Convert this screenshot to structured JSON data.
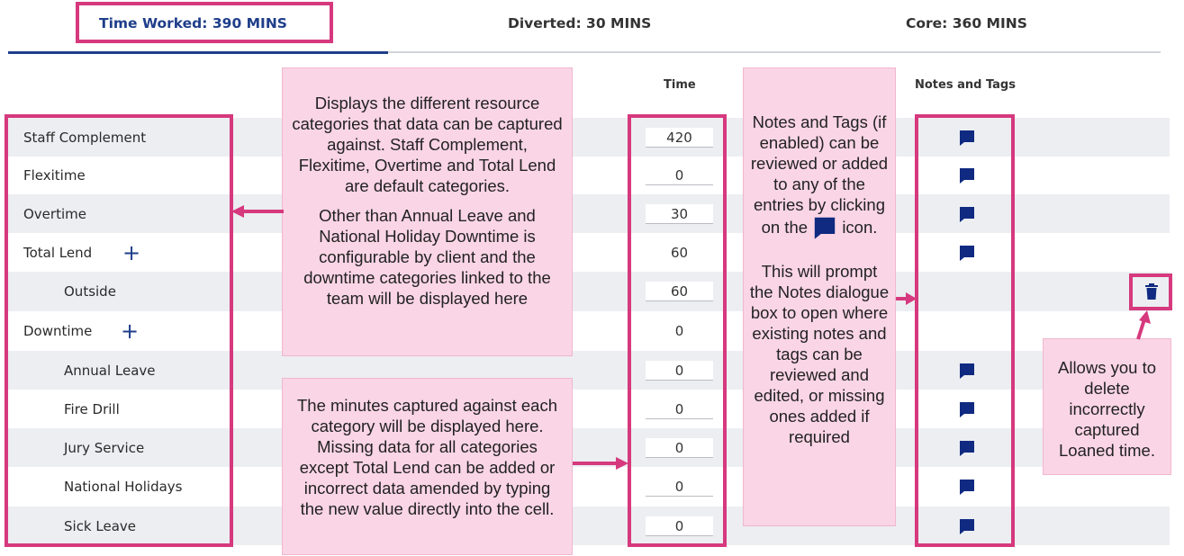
{
  "tabs": [
    {
      "label": "Time Worked: 390 MINS"
    },
    {
      "label": "Diverted: 30 MINS"
    },
    {
      "label": "Core: 360 MINS"
    }
  ],
  "columns": {
    "time": "Time",
    "notes": "Notes and Tags"
  },
  "rows": [
    {
      "label": "Staff Complement",
      "value": "420"
    },
    {
      "label": "Flexitime",
      "value": "0"
    },
    {
      "label": "Overtime",
      "value": "30"
    },
    {
      "label": "Total Lend",
      "value": "60"
    },
    {
      "label": "Outside",
      "value": "60"
    },
    {
      "label": "Downtime",
      "value": "0"
    },
    {
      "label": "Annual Leave",
      "value": "0"
    },
    {
      "label": "Fire Drill",
      "value": "0"
    },
    {
      "label": "Jury Service",
      "value": "0"
    },
    {
      "label": "National Holidays",
      "value": "0"
    },
    {
      "label": "Sick Leave",
      "value": "0"
    }
  ],
  "annotations": {
    "categories_p1": "Displays the different resource categories that data can be captured against. Staff Complement, Flexitime, Overtime and Total Lend are default categories.",
    "categories_p2": "Other than Annual Leave and National Holiday Downtime is configurable by client and the downtime categories linked to the team will be displayed here",
    "minutes": "The minutes captured against each category will be displayed here. Missing data for all categories except Total Lend can be added or incorrect data amended by typing the new value directly into the cell.",
    "notes_p1a": "Notes and Tags (if enabled) can be reviewed or added to any of the entries by clicking on the",
    "notes_p1b": "icon.",
    "notes_p2": "This will prompt the Notes dialogue box to open where existing notes and tags can be reviewed and edited, or missing ones added if required",
    "delete": "Allows you to delete incorrectly captured Loaned time."
  },
  "colors": {
    "accent": "#1f3e8a",
    "highlight": "#d6397d",
    "annotation_bg": "#fad5e5",
    "row_shade": "#eceef2"
  },
  "icons": {
    "note": "note-icon",
    "trash": "trash-icon",
    "plus": "plus-icon"
  }
}
